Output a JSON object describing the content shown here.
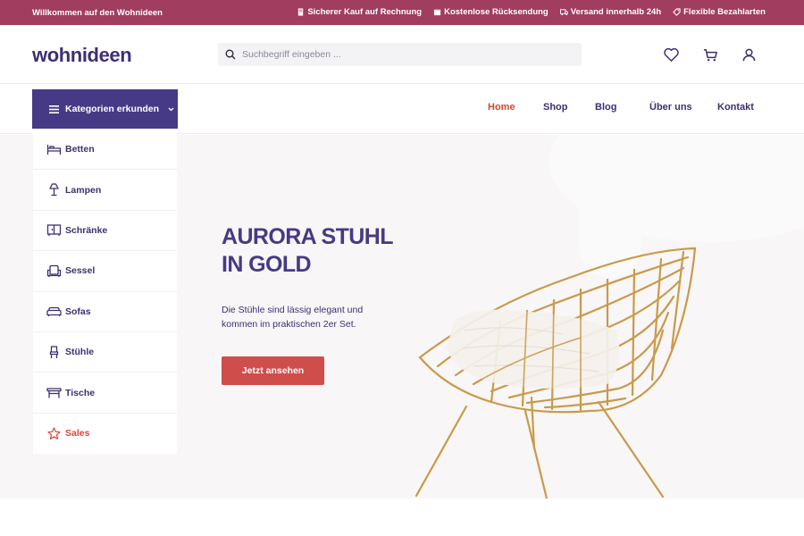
{
  "topbar": {
    "welcome": "Willkommen auf den Wohnideen",
    "badges": [
      {
        "icon": "receipt-icon",
        "label": "Sicherer Kauf auf Rechnung"
      },
      {
        "icon": "box-icon",
        "label": "Kostenlose Rücksendung"
      },
      {
        "icon": "truck-icon",
        "label": "Versand innerhalb 24h"
      },
      {
        "icon": "tag-icon",
        "label": "Flexible Bezahlarten"
      }
    ],
    "bg_color": "#a13d5f"
  },
  "header": {
    "logo": "wohnideen",
    "search": {
      "placeholder": "Suchbegriff eingeben ...",
      "value": ""
    },
    "icons": [
      "heart-icon",
      "cart-icon",
      "user-icon"
    ]
  },
  "nav": {
    "categories_label": "Kategorien erkunden",
    "links": [
      {
        "label": "Home",
        "active": true
      },
      {
        "label": "Shop"
      },
      {
        "label": "Blog"
      },
      {
        "label": "Über uns"
      },
      {
        "label": "Kontakt"
      }
    ],
    "accent_color": "#463a86",
    "active_color": "#d04a2d"
  },
  "sidebar": {
    "items": [
      {
        "label": "Betten",
        "icon": "bed-icon"
      },
      {
        "label": "Lampen",
        "icon": "lamp-icon"
      },
      {
        "label": "Schränke",
        "icon": "cabinet-icon"
      },
      {
        "label": "Sessel",
        "icon": "armchair-icon"
      },
      {
        "label": "Sofas",
        "icon": "sofa-icon"
      },
      {
        "label": "Stühle",
        "icon": "chair-icon"
      },
      {
        "label": "Tische",
        "icon": "table-icon"
      },
      {
        "label": "Sales",
        "icon": "star-icon"
      }
    ]
  },
  "hero": {
    "title_line1": "AURORA STUHL",
    "title_line2": "IN GOLD",
    "text": "Die Stühle sind lässig elegant und kommen im praktischen 2er Set.",
    "button": "Jetzt ansehen",
    "button_color": "#cf4e4b"
  }
}
